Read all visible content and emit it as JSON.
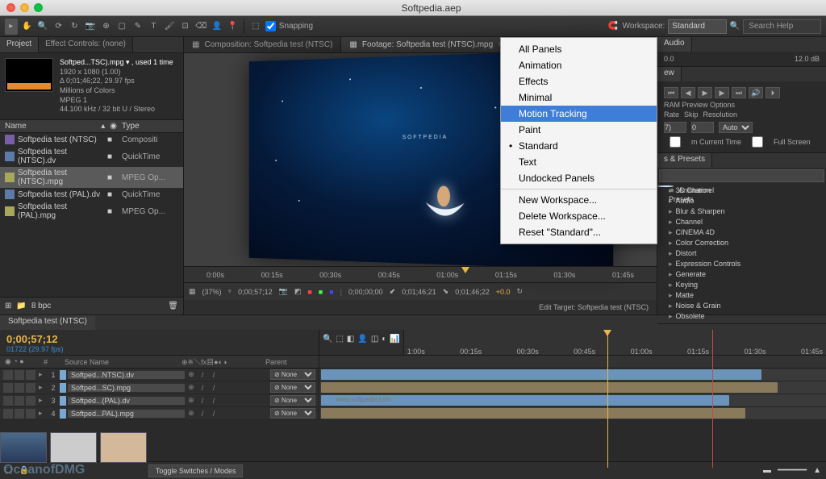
{
  "window": {
    "title": "Softpedia.aep"
  },
  "toolbar": {
    "snapping": "Snapping",
    "workspace_label": "Workspace:",
    "workspace_value": "Standard",
    "search_placeholder": "Search Help"
  },
  "workspace_menu": {
    "items": [
      "All Panels",
      "Animation",
      "Effects",
      "Minimal",
      "Motion Tracking",
      "Paint",
      "Standard",
      "Text",
      "Undocked Panels"
    ],
    "highlighted": "Motion Tracking",
    "checked": "Standard",
    "actions": [
      "New Workspace...",
      "Delete Workspace...",
      "Reset \"Standard\"..."
    ]
  },
  "project": {
    "tabs": [
      "Project",
      "Effect Controls: (none)"
    ],
    "selected_name": "Softped...TSC).mpg ▾ , used 1 time",
    "res": "1920 x 1080 (1.00)",
    "dur": "Δ 0;01;46;22, 29.97 fps",
    "col": "Millions of Colors",
    "codec": "MPEG 1",
    "audio": "44.100 kHz / 32 bit U / Stereo",
    "cols": {
      "name": "Name",
      "type": "Type"
    },
    "items": [
      {
        "name": "Softpedia test (NTSC)",
        "type": "Compositi",
        "icon": "comp"
      },
      {
        "name": "Softpedia test (NTSC).dv",
        "type": "QuickTime",
        "icon": "qt"
      },
      {
        "name": "Softpedia test (NTSC).mpg",
        "type": "MPEG Op...",
        "icon": "mpg",
        "sel": true
      },
      {
        "name": "Softpedia test (PAL).dv",
        "type": "QuickTime",
        "icon": "qt"
      },
      {
        "name": "Softpedia test (PAL).mpg",
        "type": "MPEG Op...",
        "icon": "mpg"
      }
    ],
    "bpc": "8 bpc"
  },
  "composition": {
    "tabs": [
      {
        "label": "Composition: Softpedia test (NTSC)"
      },
      {
        "label": "Footage: Softpedia test (NTSC).mpg",
        "active": true
      }
    ],
    "logo": "SOFTPEDIA",
    "ruler": [
      "0:00s",
      "00:15s",
      "00:30s",
      "00:45s",
      "01:00s",
      "01:15s",
      "01:30s",
      "01:45s"
    ],
    "zoom": "(37%)",
    "cur_time": "0;00;57;12",
    "time1": "0;00;00;00",
    "time2": "0;01;46;21",
    "time3": "0;01;46;22",
    "offset": "+0.0",
    "edit_target": "Edit Target: Softpedia test (NTSC)"
  },
  "audio_panel": {
    "tab": "Audio",
    "left": "0.0",
    "right": "12.0 dB"
  },
  "preview_panel": {
    "tab": "ew",
    "options": "RAM Preview Options",
    "cols": [
      "Rate",
      "Skip",
      "Resolution"
    ],
    "rate": "7)",
    "skip": "0",
    "res": "Auto",
    "from_current": "m Current Time",
    "fullscreen": "Full Screen"
  },
  "effects_panel": {
    "tab": "s & Presets",
    "items": [
      "Animation Presets",
      "3D Channel",
      "Audio",
      "Blur & Sharpen",
      "Channel",
      "CINEMA 4D",
      "Color Correction",
      "Distort",
      "Expression Controls",
      "Generate",
      "Keying",
      "Matte",
      "Noise & Grain",
      "Obsolete"
    ]
  },
  "timeline": {
    "tab": "Softpedia test (NTSC)",
    "timecode": "0;00;57;12",
    "frames": "01722 (29.97 fps)",
    "cols": {
      "num": "#",
      "src": "Source Name",
      "sw": "⊕※＼fx目●◐◑",
      "parent": "Parent"
    },
    "layers": [
      {
        "n": "1",
        "name": "Softped...NTSC).dv",
        "parent": "None"
      },
      {
        "n": "2",
        "name": "Softped...SC).mpg",
        "parent": "None"
      },
      {
        "n": "3",
        "name": "Softped...(PAL).dv",
        "parent": "None"
      },
      {
        "n": "4",
        "name": "Softped...PAL).mpg",
        "parent": "None"
      }
    ],
    "ruler": [
      "1:00s",
      "00:15s",
      "00:30s",
      "00:45s",
      "01:00s",
      "01:15s",
      "01:30s",
      "01:45s"
    ],
    "watermark": "www.softpedia.com",
    "toggle": "Toggle Switches / Modes"
  },
  "watermark": "OceanofDMG"
}
